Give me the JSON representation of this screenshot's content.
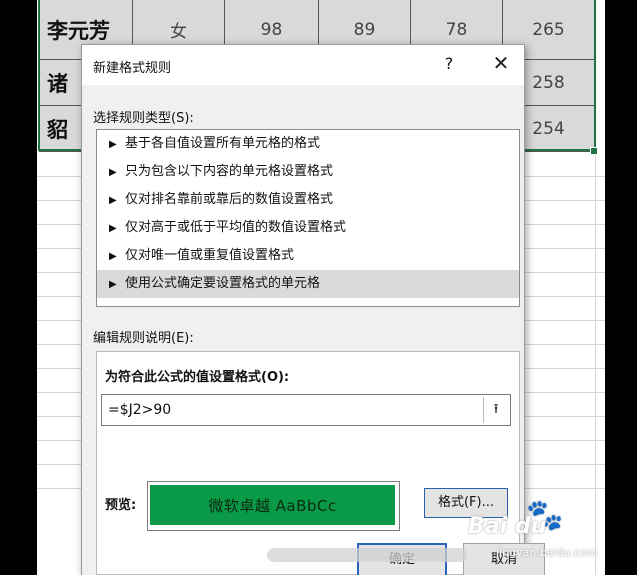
{
  "sheet": {
    "rows": [
      {
        "name": "李元芳",
        "gender": "女",
        "v1": "98",
        "v2": "89",
        "v3": "78",
        "total": "265"
      },
      {
        "name": "诸",
        "gender": "",
        "v1": "",
        "v2": "",
        "v3": "",
        "total": "258"
      },
      {
        "name": "貂",
        "gender": "",
        "v1": "",
        "v2": "",
        "v3": "",
        "total": "254"
      }
    ]
  },
  "dialog": {
    "title": "新建格式规则",
    "help": "?",
    "close": "✕",
    "select_type_label": "选择规则类型(S):",
    "rule_types": [
      "基于各自值设置所有单元格的格式",
      "只为包含以下内容的单元格设置格式",
      "仅对排名靠前或靠后的数值设置格式",
      "仅对高于或低于平均值的数值设置格式",
      "仅对唯一值或重复值设置格式",
      "使用公式确定要设置格式的单元格"
    ],
    "selected_index": 5,
    "edit_label": "编辑规则说明(E):",
    "formula_label": "为符合此公式的值设置格式(O):",
    "formula_value": "=$J2>90",
    "collapse_icon": "⯭",
    "preview_label": "预览:",
    "preview_text": "微软卓越  AaBbCc",
    "preview_color": "#0a9a47",
    "format_button": "格式(F)...",
    "ok_button": "确定",
    "cancel_button": "取消"
  },
  "watermark": {
    "logo": "Bai du",
    "url": "jingyan.baidu.com"
  }
}
